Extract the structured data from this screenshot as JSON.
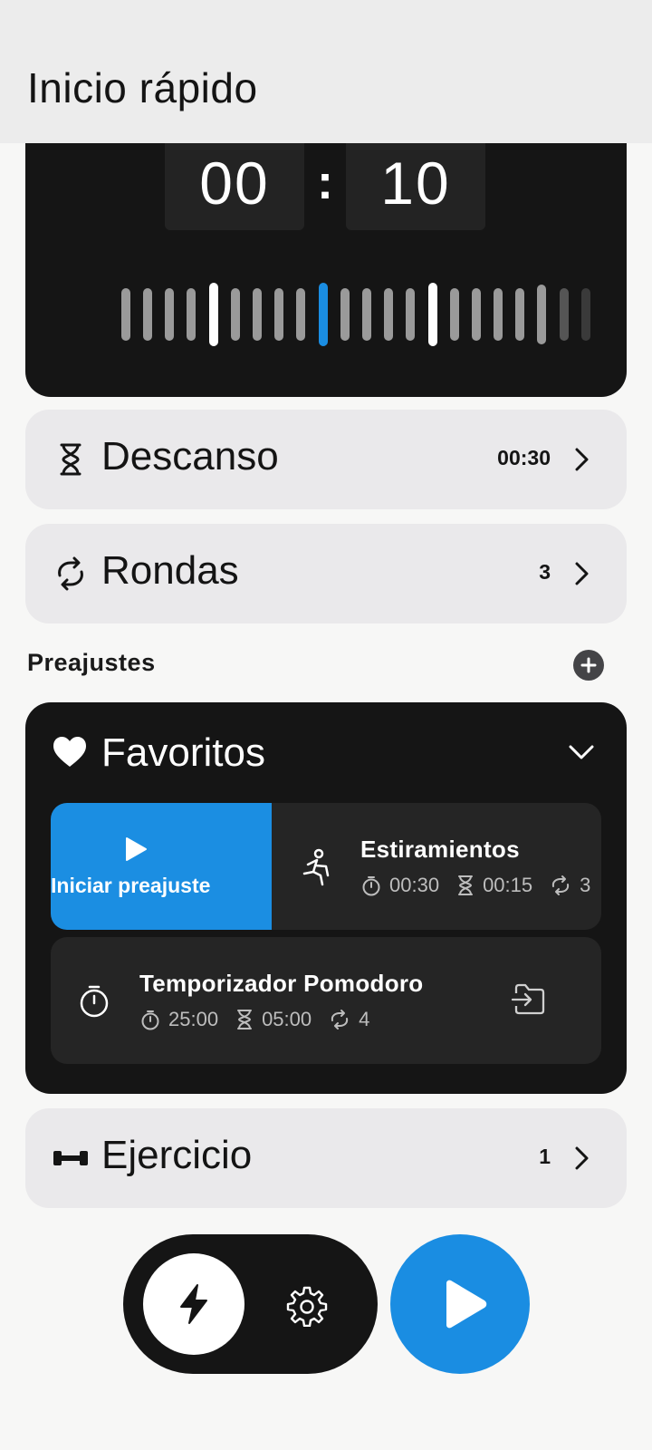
{
  "header": {
    "title": "Inicio rápido"
  },
  "timer": {
    "minutes": "00",
    "separator": ":",
    "seconds": "10"
  },
  "rest": {
    "label": "Descanso",
    "value": "00:30",
    "icon": "hourglass-icon"
  },
  "rounds": {
    "label": "Rondas",
    "value": "3",
    "icon": "repeat-icon"
  },
  "presets": {
    "section_label": "Preajustes",
    "group": {
      "title": "Favoritos",
      "icon": "heart-icon"
    },
    "swipe_action": "Iniciar preajuste",
    "items": [
      {
        "title": "Estiramientos",
        "work": "00:30",
        "rest": "00:15",
        "rounds": "3",
        "icon": "stretching-person-icon"
      },
      {
        "title": "Temporizador Pomodoro",
        "work": "25:00",
        "rest": "05:00",
        "rounds": "4",
        "icon": "stopwatch-icon"
      }
    ]
  },
  "exercise": {
    "label": "Ejercicio",
    "value": "1",
    "icon": "dumbbell-icon"
  },
  "colors": {
    "accent": "#1a8de2",
    "dark_card": "#151515",
    "light_card": "#eae9eb"
  }
}
